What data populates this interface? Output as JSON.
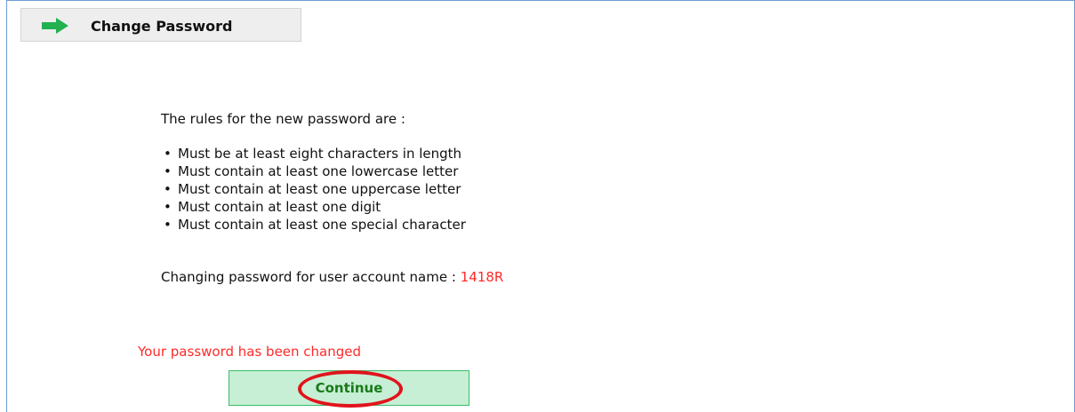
{
  "tab": {
    "label": "Change Password",
    "icon": "right-arrow-icon",
    "icon_color": "#21b14f"
  },
  "rules": {
    "intro": "The rules for the new password are :",
    "items": [
      "Must be at least eight characters in length",
      "Must contain at least one lowercase letter",
      "Must contain at least one uppercase letter",
      "Must contain at least one digit",
      "Must contain at least one special character"
    ]
  },
  "account": {
    "prefix": "Changing password for user account name : ",
    "name": "1418R",
    "name_color": "#ff2a2a"
  },
  "status": {
    "message": "Your password has been changed",
    "color": "#ff2a2a"
  },
  "actions": {
    "continue_label": "Continue"
  },
  "annotation": {
    "highlight_color": "#e0141c"
  }
}
